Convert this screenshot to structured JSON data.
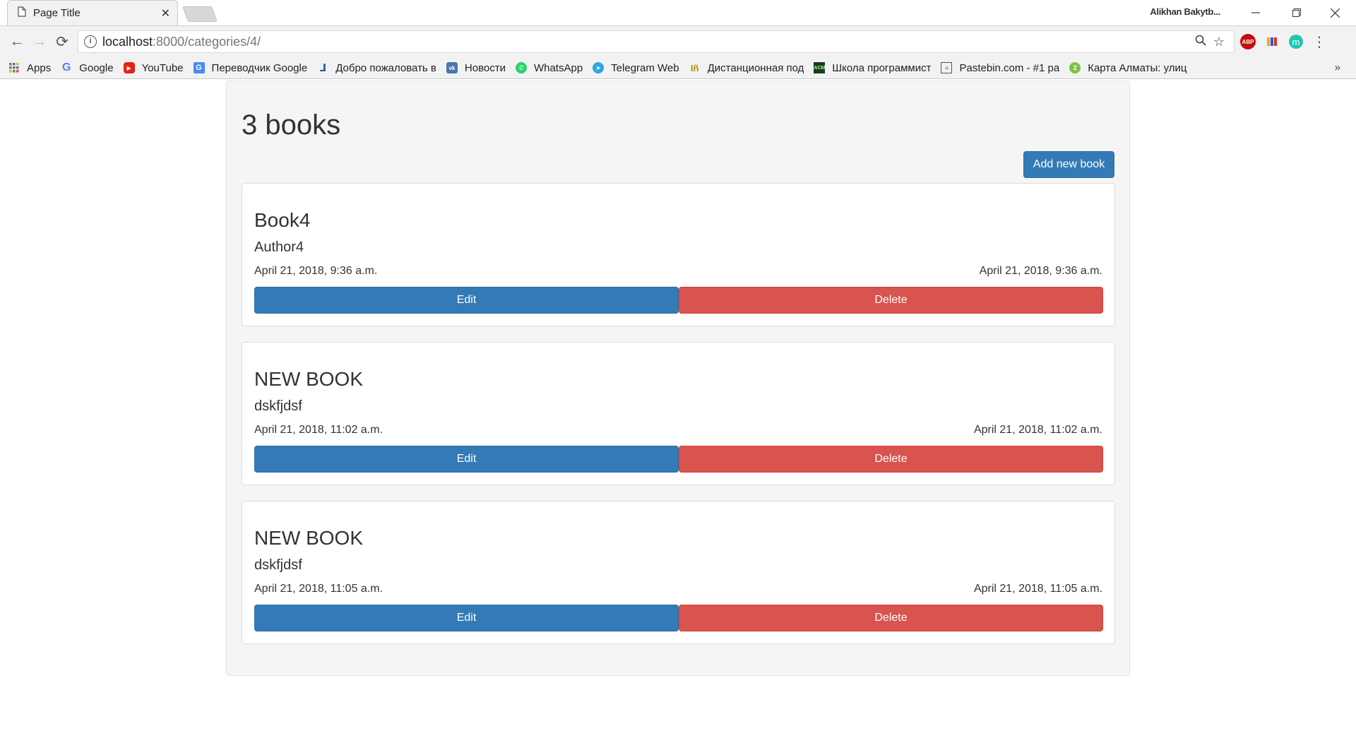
{
  "browser": {
    "tab_title": "Page Title",
    "user_name": "Alikhan Bakytb...",
    "url_host": "localhost",
    "url_path": ":8000/categories/4/",
    "bookmarks": [
      {
        "label": "Apps",
        "icon": "apps-grid-icon"
      },
      {
        "label": "Google",
        "icon": "google-icon"
      },
      {
        "label": "YouTube",
        "icon": "youtube-icon"
      },
      {
        "label": "Переводчик Google",
        "icon": "google-translate-icon"
      },
      {
        "label": "Добро пожаловать в",
        "icon": "welcome-site-icon"
      },
      {
        "label": "Новости",
        "icon": "vk-icon"
      },
      {
        "label": "WhatsApp",
        "icon": "whatsapp-icon"
      },
      {
        "label": "Telegram Web",
        "icon": "telegram-icon"
      },
      {
        "label": "Дистанционная под",
        "icon": "distance-learning-icon"
      },
      {
        "label": "Школа программист",
        "icon": "programming-school-icon"
      },
      {
        "label": "Pastebin.com - #1 pa",
        "icon": "pastebin-icon"
      },
      {
        "label": "Карта Алматы: улиц",
        "icon": "map-2gis-icon"
      }
    ],
    "more_label": "»"
  },
  "page": {
    "heading": "3 books",
    "add_button": "Add new book",
    "books": [
      {
        "title": "Book4",
        "author": "Author4",
        "created": "April 21, 2018, 9:36 a.m.",
        "updated": "April 21, 2018, 9:36 a.m.",
        "edit": "Edit",
        "delete": "Delete"
      },
      {
        "title": "NEW BOOK",
        "author": "dskfjdsf",
        "created": "April 21, 2018, 11:02 a.m.",
        "updated": "April 21, 2018, 11:02 a.m.",
        "edit": "Edit",
        "delete": "Delete"
      },
      {
        "title": "NEW BOOK",
        "author": "dskfjdsf",
        "created": "April 21, 2018, 11:05 a.m.",
        "updated": "April 21, 2018, 11:05 a.m.",
        "edit": "Edit",
        "delete": "Delete"
      }
    ]
  },
  "colors": {
    "primary": "#337ab7",
    "danger": "#d9534f",
    "well": "#f5f5f5"
  }
}
